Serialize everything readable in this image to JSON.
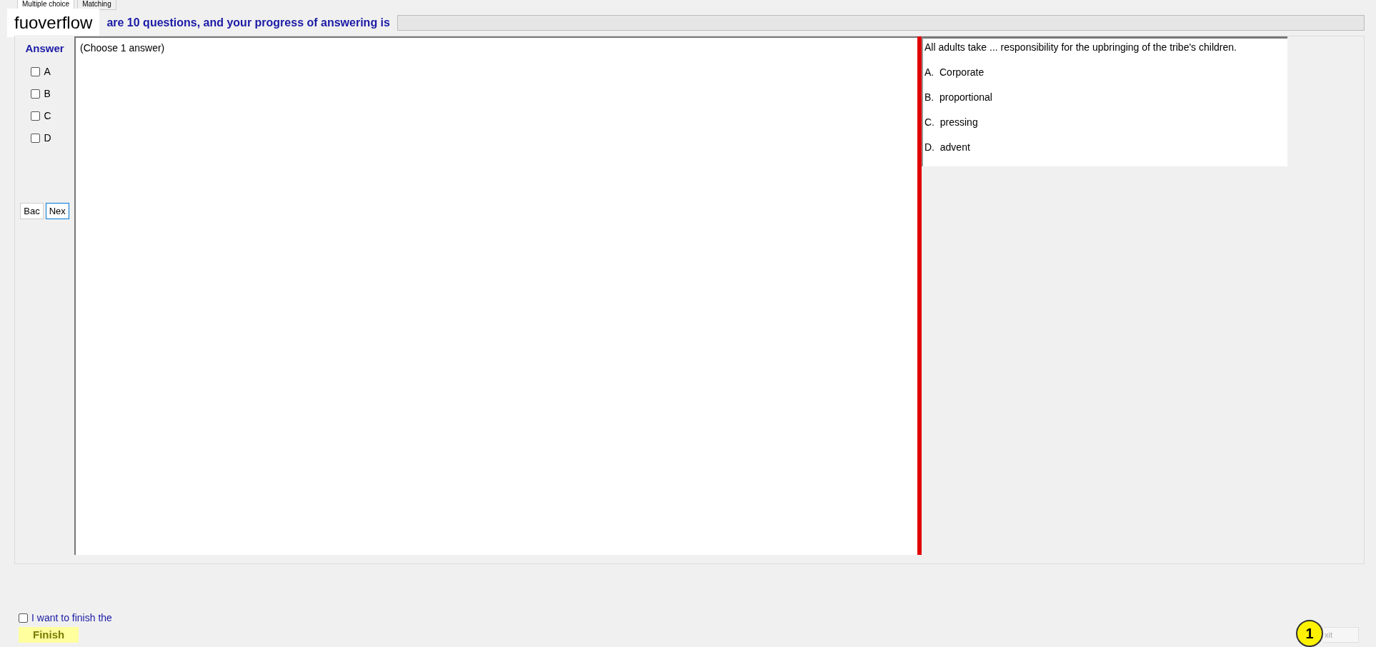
{
  "tabs": [
    {
      "label": "Multiple choice",
      "selected": true
    },
    {
      "label": "Matching",
      "selected": false
    }
  ],
  "header": {
    "title": "fuoverflow",
    "progress_text": "are 10 questions, and your progress of answering is",
    "progress": {
      "level": 0
    }
  },
  "answer_panel": {
    "heading": "Answer",
    "options": [
      {
        "label": "A",
        "checked": false
      },
      {
        "label": "B",
        "checked": false
      },
      {
        "label": "C",
        "checked": false
      },
      {
        "label": "D",
        "checked": false
      }
    ],
    "buttons": [
      {
        "label": "Bac",
        "focused": false
      },
      {
        "label": "Nex",
        "focused": true
      }
    ]
  },
  "instruction": "(Choose 1 answer)",
  "question": {
    "text": "All adults take ... responsibility for the upbringing of the tribe's children.",
    "choices": [
      "A.  Corporate",
      "B.  proportional",
      "C.  pressing",
      "D.  advent"
    ]
  },
  "footer": {
    "finish_check": {
      "label": "I want to finish the",
      "checked": false
    },
    "finish_button": "Finish",
    "exit_button": "xit",
    "marker": "1"
  }
}
